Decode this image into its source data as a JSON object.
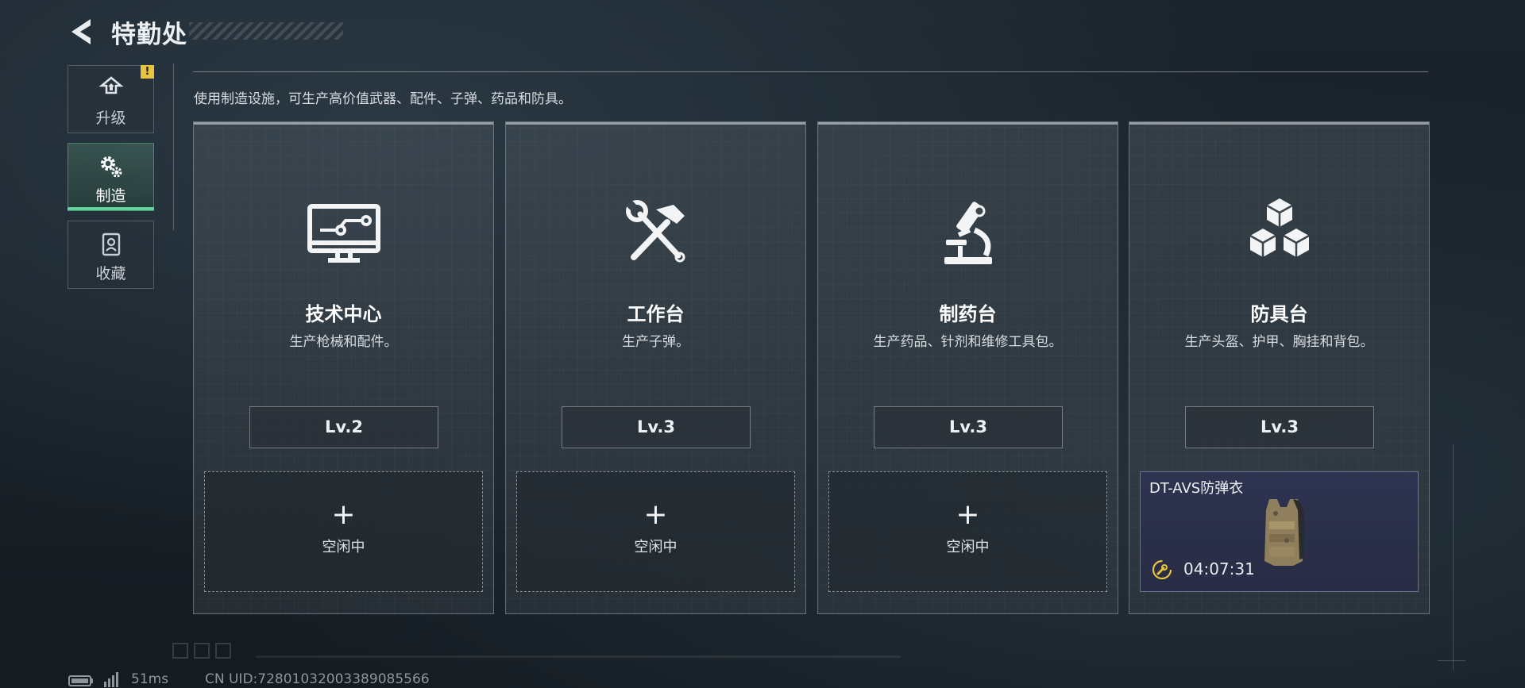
{
  "header": {
    "title": "特勤处"
  },
  "sidebar": {
    "items": [
      {
        "label": "升级",
        "icon": "upgrade-icon",
        "active": false,
        "alert": "!"
      },
      {
        "label": "制造",
        "icon": "crafting-gear-icon",
        "active": true
      },
      {
        "label": "收藏",
        "icon": "collection-icon",
        "active": false
      }
    ]
  },
  "description": "使用制造设施，可生产高价值武器、配件、子弹、药品和防具。",
  "cards": [
    {
      "name": "技术中心",
      "sub": "生产枪械和配件。",
      "level": "Lv.2",
      "slot": {
        "state": "idle",
        "plus": "+",
        "label": "空闲中"
      }
    },
    {
      "name": "工作台",
      "sub": "生产子弹。",
      "level": "Lv.3",
      "slot": {
        "state": "idle",
        "plus": "+",
        "label": "空闲中"
      }
    },
    {
      "name": "制药台",
      "sub": "生产药品、针剂和维修工具包。",
      "level": "Lv.3",
      "slot": {
        "state": "idle",
        "plus": "+",
        "label": "空闲中"
      }
    },
    {
      "name": "防具台",
      "sub": "生产头盔、护甲、胸挂和背包。",
      "level": "Lv.3",
      "slot": {
        "state": "busy",
        "item": "DT-AVS防弹衣",
        "timer": "04:07:31"
      }
    }
  ],
  "footer": {
    "latency": "51ms",
    "uid": "CN UID:7280103200338908556​6"
  },
  "colors": {
    "accent_green": "#5fd49a",
    "alert_yellow": "#e7c340",
    "timer_yellow": "#e8c23b"
  }
}
